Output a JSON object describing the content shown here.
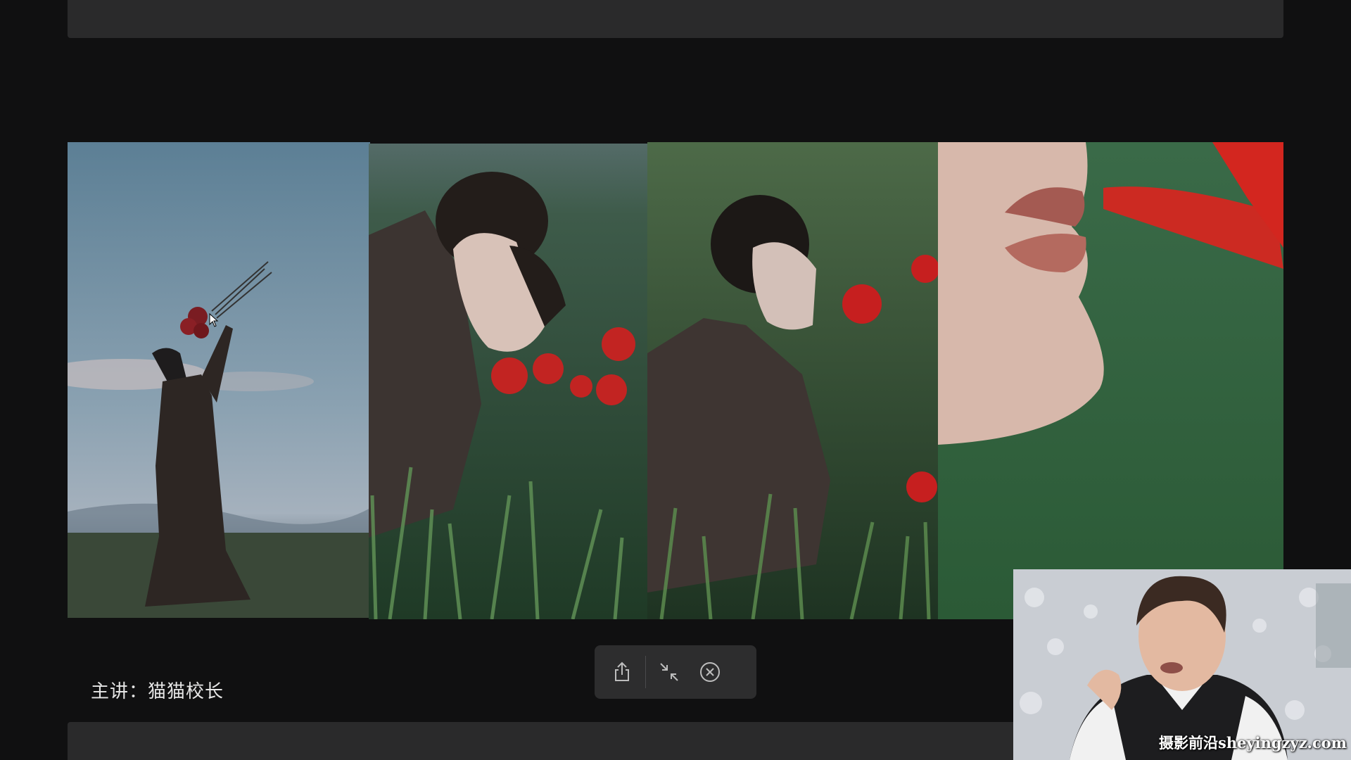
{
  "presenter_label": "主讲：猫猫校长",
  "toolbar": {
    "share_icon": "share-icon",
    "exit_fullscreen_icon": "exit-fullscreen-icon",
    "close_icon": "close-circle-icon"
  },
  "photos": [
    {
      "subject": "woman raising red roses against the sky"
    },
    {
      "subject": "woman smelling red roses in grass"
    },
    {
      "subject": "woman kneeling in grass holding red roses"
    },
    {
      "subject": "close-up of lips touching red petal"
    }
  ],
  "webcam": {
    "watermark": "摄影前沿sheyingzyz.com"
  },
  "colors": {
    "background": "#101011",
    "bar": "#2a2a2b",
    "toolbar": "#2d2d2e",
    "rose": "#c8201f"
  }
}
